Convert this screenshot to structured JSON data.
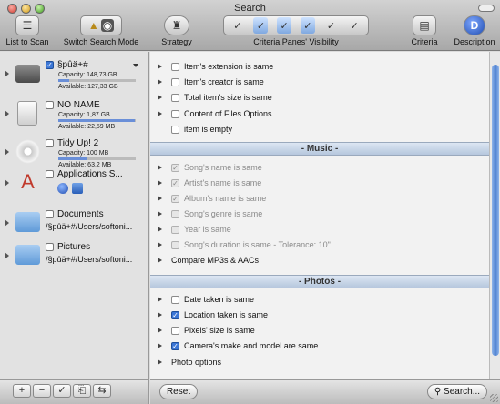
{
  "window": {
    "title": "Search"
  },
  "toolbar": {
    "list_to_scan": "List to Scan",
    "switch_mode": "Switch Search Mode",
    "strategy": "Strategy",
    "criteria_visibility": "Criteria Panes' Visibility",
    "criteria": "Criteria",
    "description": "Description"
  },
  "sidebar": {
    "volumes": [
      {
        "name": "§pûä+#",
        "capacity": "Capacity: 148,73 GB",
        "available": "Available: 127,33 GB",
        "checked": true,
        "used_fraction": 0.14
      },
      {
        "name": "NO NAME",
        "capacity": "Capacity: 1,87 GB",
        "available": "Available: 22,59 MB",
        "checked": false,
        "used_fraction": 0.99
      },
      {
        "name": "Tidy Up! 2",
        "capacity": "Capacity: 100 MB",
        "available": "Available: 63,2 MB",
        "checked": false,
        "used_fraction": 0.37
      },
      {
        "name": "Applications S...",
        "checked": false
      },
      {
        "name": "Documents",
        "path": "/§pûä+#/Users/softoni...",
        "checked": false
      },
      {
        "name": "Pictures",
        "path": "/§pûä+#/Users/softoni...",
        "checked": false
      }
    ],
    "buttons": [
      "+",
      "−",
      "✓",
      "⎗",
      "⇆"
    ]
  },
  "main": {
    "top_items": [
      {
        "label": "Item's extension is same",
        "checked": false
      },
      {
        "label": "Item's creator is same",
        "checked": false
      },
      {
        "label": "Total item's size is same",
        "checked": false
      },
      {
        "label": "Content of Files Options",
        "checkbox": false
      },
      {
        "label": "item is empty",
        "checked": false
      }
    ],
    "music_header": "- Music -",
    "music_items": [
      {
        "label": "Song's name is same",
        "checked": true,
        "dim": true
      },
      {
        "label": "Artist's name is same",
        "checked": true,
        "dim": true
      },
      {
        "label": "Album's name is same",
        "checked": true,
        "dim": true
      },
      {
        "label": "Song's genre is same",
        "checked": false,
        "dim": true
      },
      {
        "label": "Year is same",
        "checked": false,
        "dim": true
      },
      {
        "label": "Song's duration is same - Tolerance: 10\"",
        "checked": false,
        "dim": true
      },
      {
        "label": "Compare MP3s & AACs",
        "checkbox": false
      }
    ],
    "photos_header": "- Photos -",
    "photo_items": [
      {
        "label": "Date taken is same",
        "checked": false
      },
      {
        "label": "Location taken is same",
        "checked": true
      },
      {
        "label": "Pixels' size is same",
        "checked": false
      },
      {
        "label": "Camera's make and model are same",
        "checked": true
      },
      {
        "label": "Photo options",
        "checkbox": false
      }
    ]
  },
  "footer": {
    "reset": "Reset",
    "search": "Search..."
  }
}
